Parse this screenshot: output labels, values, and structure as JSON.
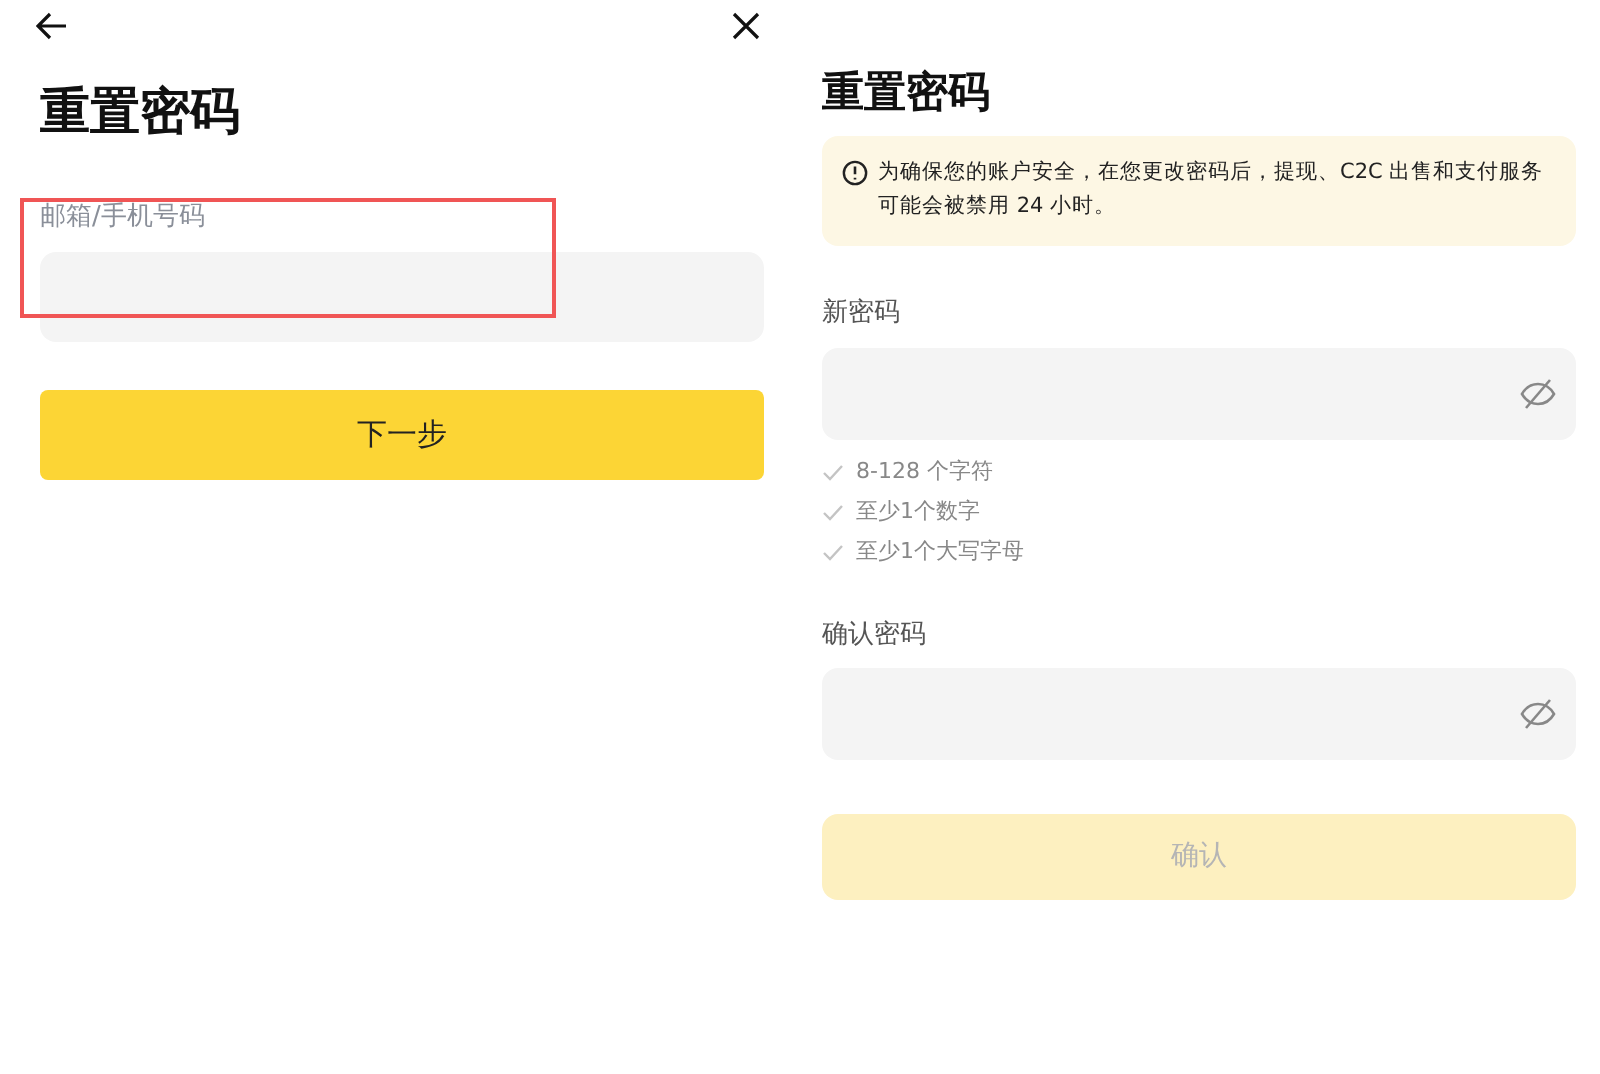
{
  "left": {
    "title": "重置密码",
    "field": {
      "label": "邮箱/手机号码",
      "highlighted": true
    },
    "button": {
      "label": "下一步",
      "disabled": false
    }
  },
  "right": {
    "title": "重置密码",
    "notice": "为确保您的账户安全，在您更改密码后，提现、C2C 出售和支付服务可能会被禁用 24 小时。",
    "new_password": {
      "label": "新密码"
    },
    "rules": [
      {
        "text": "8-128 个字符",
        "met": false
      },
      {
        "text": "至少1个数字",
        "met": false
      },
      {
        "text": "至少1个大写字母",
        "met": false
      }
    ],
    "confirm_password": {
      "label": "确认密码"
    },
    "button": {
      "label": "确认",
      "disabled": true
    }
  }
}
